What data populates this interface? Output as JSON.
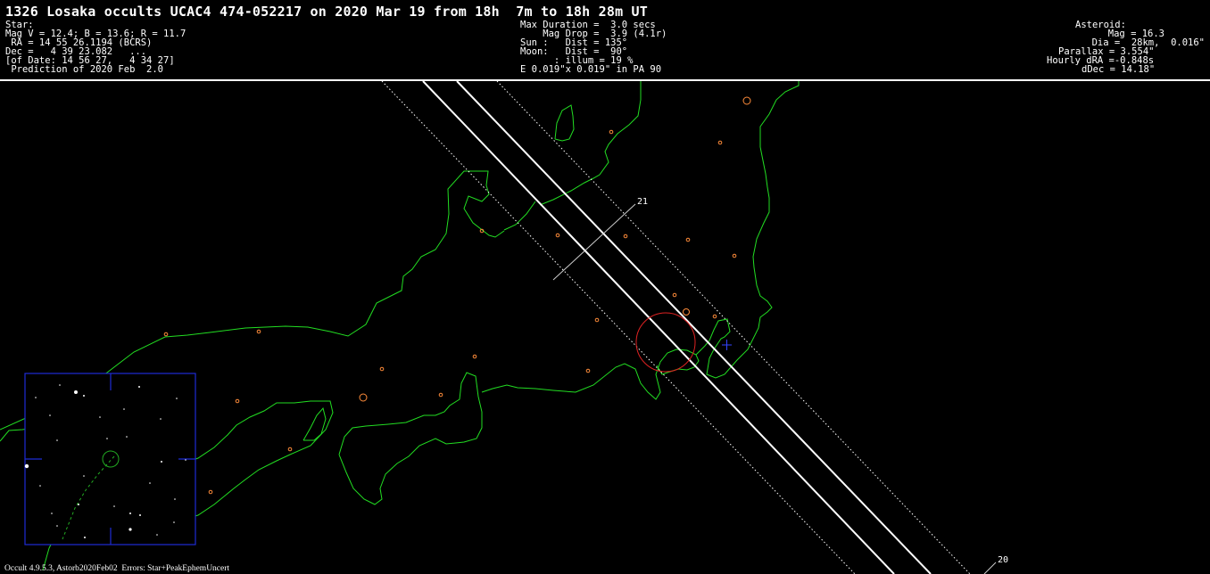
{
  "header": {
    "title": "1326 Losaka occults UCAC4 474-052217 on 2020 Mar 19 from 18h  7m to 18h 28m UT",
    "star": {
      "heading": "Star:",
      "mag": "Mag V = 12.4; B = 13.6; R = 11.7",
      "ra": " RA = 14 55 26.1194 (BCRS)",
      "dec": "Dec =   4 39 23.082   ...",
      "of_date": "[of Date: 14 56 27,   4 34 27]",
      "prediction": " Prediction of 2020 Feb  2.0"
    },
    "event": {
      "max_duration": "Max Duration =  3.0 secs",
      "mag_drop": "    Mag Drop =  3.9 (4.1r)",
      "sun": "Sun :   Dist = 135°",
      "moon": "Moon:   Dist =  90°",
      "illum": "      : illum = 19 %",
      "ellipse": "E 0.019\"x 0.019\" in PA 90"
    },
    "asteroid": {
      "heading": "Asteroid:",
      "mag": "Mag = 16.3",
      "dia": "Dia =  28km,  0.016\"",
      "parallax": "Parallax = 3.554\"",
      "hourly_dra": "Hourly dRA =-0.848s",
      "ddec": "dDec = 14.18\""
    }
  },
  "map": {
    "time_labels": [
      "21",
      "20"
    ],
    "colors": {
      "background": "#000000",
      "coastline": "#22dd22",
      "path": "#ffffff",
      "sites": "#ff8c3a",
      "ellipse": "#dd2222",
      "cross": "#3344ff",
      "finder_frame": "#1e2cd6",
      "finder_track": "#22aa22"
    }
  },
  "footer": {
    "text": "Occult 4.9.5.3, Astorb2020Feb02  Errors: Star+PeakEphemUncert"
  }
}
